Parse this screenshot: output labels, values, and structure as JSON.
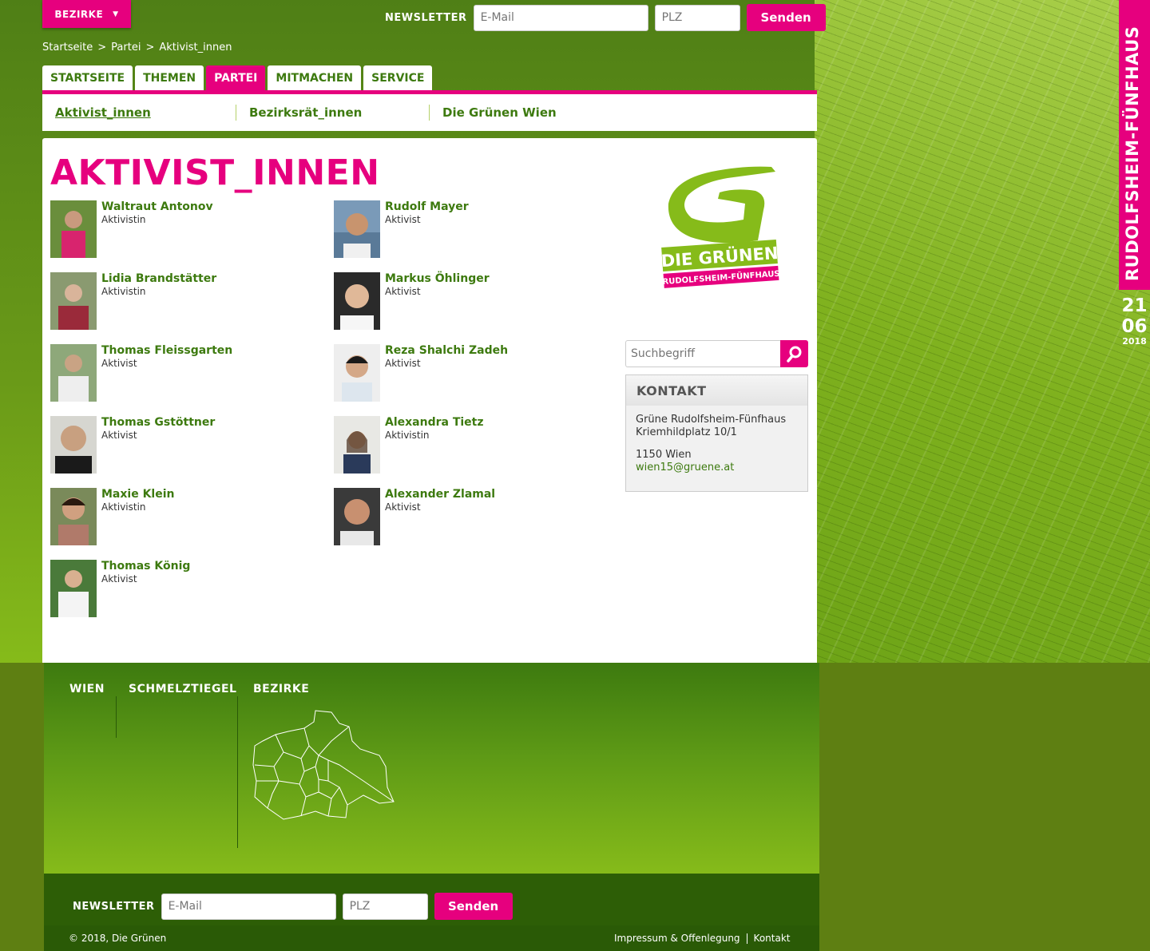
{
  "header": {
    "bezirke_label": "BEZIRKE",
    "newsletter_label": "NEWSLETTER",
    "email_placeholder": "E-Mail",
    "plz_placeholder": "PLZ",
    "send_label": "Senden"
  },
  "breadcrumb": [
    "Startseite",
    ">",
    "Partei",
    ">",
    "Aktivist_innen"
  ],
  "tabs": [
    {
      "label": "STARTSEITE",
      "active": false
    },
    {
      "label": "THEMEN",
      "active": false
    },
    {
      "label": "PARTEI",
      "active": true
    },
    {
      "label": "MITMACHEN",
      "active": false
    },
    {
      "label": "SERVICE",
      "active": false
    }
  ],
  "subnav": [
    {
      "label": "Aktivist_innen",
      "active": true
    },
    {
      "label": "Bezirksrät_innen",
      "active": false
    },
    {
      "label": "Die Grünen Wien",
      "active": false
    }
  ],
  "main": {
    "title": "AKTIVIST_INNEN",
    "people": [
      {
        "name": "Waltraut Antonov",
        "role": "Aktivistin"
      },
      {
        "name": "Rudolf Mayer",
        "role": "Aktivist"
      },
      {
        "name": "Lidia Brandstätter",
        "role": "Aktivistin"
      },
      {
        "name": "Markus Öhlinger",
        "role": "Aktivist"
      },
      {
        "name": "Thomas Fleissgarten",
        "role": "Aktivist"
      },
      {
        "name": "Reza Shalchi Zadeh",
        "role": "Aktivist"
      },
      {
        "name": "Thomas Gstöttner",
        "role": "Aktivist"
      },
      {
        "name": "Alexandra Tietz",
        "role": "Aktivistin"
      },
      {
        "name": "Maxie Klein",
        "role": "Aktivistin"
      },
      {
        "name": "Alexander Zlamal",
        "role": "Aktivist"
      },
      {
        "name": "Thomas König",
        "role": "Aktivist"
      }
    ]
  },
  "logo": {
    "line1": "DIE GRÜNEN",
    "line2": "RUDOLFSHEIM-FÜNFHAUS"
  },
  "search": {
    "placeholder": "Suchbegriff"
  },
  "kontakt": {
    "title": "KONTAKT",
    "line1": "Grüne Rudolfsheim-Fünfhaus",
    "line2": "Kriemhildplatz 10/1",
    "line3": "1150 Wien",
    "email": "wien15@gruene.at"
  },
  "footer": {
    "col1": "WIEN",
    "col2": "SCHMELZTIEGEL",
    "col3": "BEZIRKE",
    "newsletter_label": "NEWSLETTER",
    "email_placeholder": "E-Mail",
    "plz_placeholder": "PLZ",
    "send_label": "Senden",
    "copyright": "© 2018, Die Grünen",
    "link_impressum": "Impressum & Offenlegung",
    "link_kontakt": "Kontakt"
  },
  "side": {
    "district": "RUDOLFSHEIM-FÜNFHAUS",
    "day": "21",
    "month": "06",
    "year": "2018"
  },
  "colors": {
    "accent": "#e6007e",
    "green": "#3d7a0f",
    "lightgreen": "#86bb1a"
  }
}
